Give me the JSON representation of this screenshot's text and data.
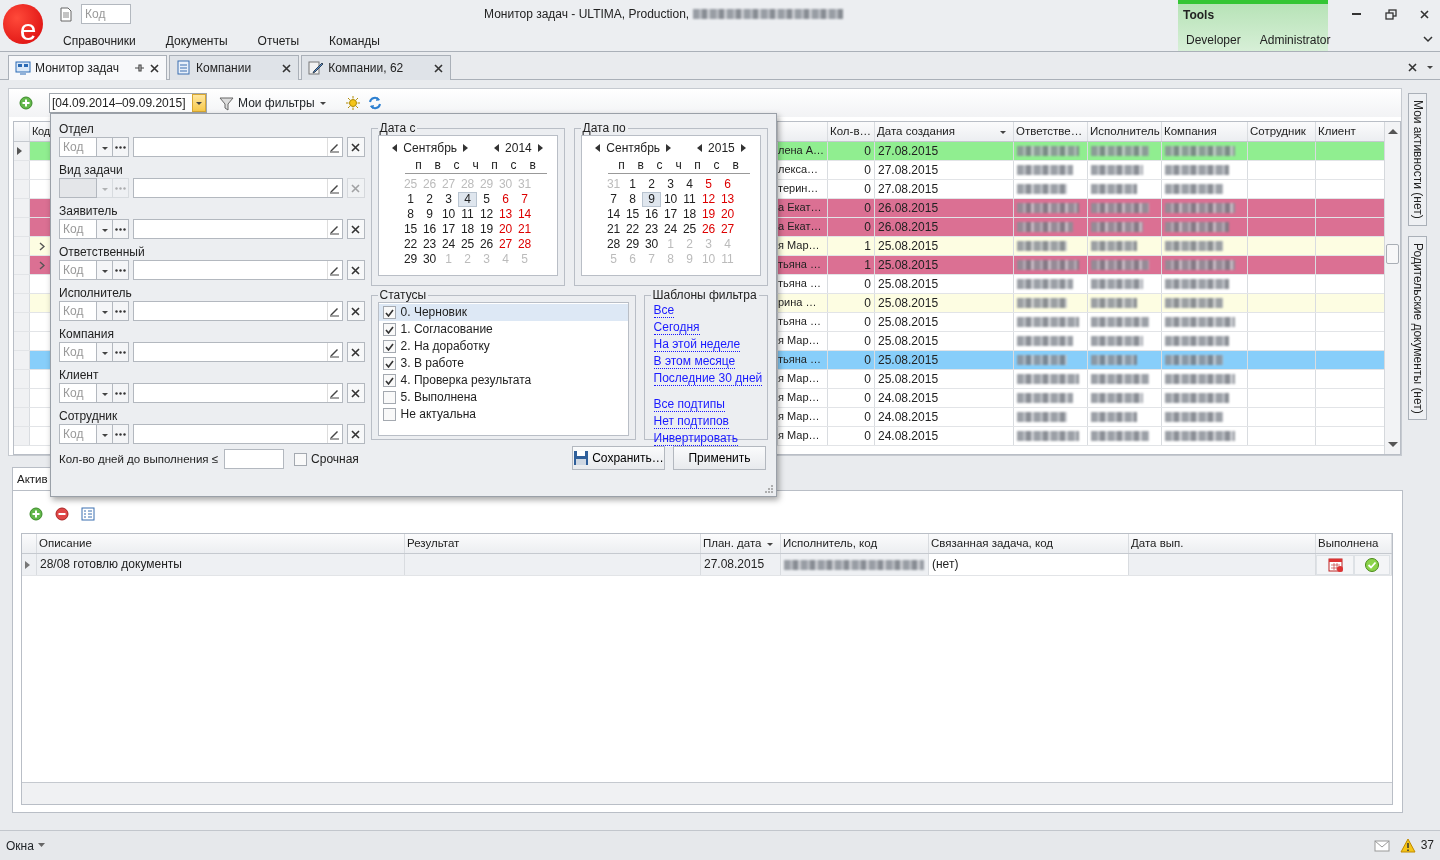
{
  "app": {
    "logo_text": "e",
    "code_field": {
      "placeholder": "Код"
    },
    "title": "Монитор задач - ULTIMA, Production,",
    "menu": [
      "Справочники",
      "Документы",
      "Отчеты",
      "Команды"
    ],
    "tools_group": {
      "title": "Tools",
      "items": [
        "Developer",
        "Administrator"
      ]
    }
  },
  "doc_tabs": [
    {
      "label": "Монитор задач",
      "kind": "monitor",
      "selected": true,
      "pinned": true
    },
    {
      "label": "Компании",
      "kind": "list",
      "selected": false,
      "pinned": false
    },
    {
      "label": "Компании, 62",
      "kind": "edit",
      "selected": false,
      "pinned": false
    }
  ],
  "toolbar": {
    "date_range": "[04.09.2014–09.09.2015]",
    "filters_button": "Мои фильтры"
  },
  "tasks_grid": {
    "columns": [
      {
        "label": "Код"
      },
      {
        "label": "Кол-в…"
      },
      {
        "label": "Дата создания",
        "sorted": true
      },
      {
        "label": "Ответстве…"
      },
      {
        "label": "Исполнитель"
      },
      {
        "label": "Компания"
      },
      {
        "label": "Сотрудник"
      },
      {
        "label": "Клиент"
      }
    ],
    "rows": [
      {
        "name": "лена А…",
        "count": "0",
        "created": "27.08.2015",
        "color": "#90ee90",
        "selected": true,
        "expandable": false
      },
      {
        "name": "лекса…",
        "count": "0",
        "created": "27.08.2015",
        "color": "#ffffff",
        "selected": false,
        "expandable": false
      },
      {
        "name": "терин…",
        "count": "0",
        "created": "27.08.2015",
        "color": "#ffffff",
        "selected": false,
        "expandable": false
      },
      {
        "name": "а Екат…",
        "count": "0",
        "created": "26.08.2015",
        "color": "#db7093",
        "selected": false,
        "expandable": false
      },
      {
        "name": "а Екат…",
        "count": "0",
        "created": "26.08.2015",
        "color": "#db7093",
        "selected": false,
        "expandable": false
      },
      {
        "name": "я Мар…",
        "count": "1",
        "created": "25.08.2015",
        "color": "#fdfde2",
        "selected": false,
        "expandable": true
      },
      {
        "name": "тьяна …",
        "count": "1",
        "created": "25.08.2015",
        "color": "#db7093",
        "selected": false,
        "expandable": true
      },
      {
        "name": "тьяна …",
        "count": "0",
        "created": "25.08.2015",
        "color": "#ffffff",
        "selected": false,
        "expandable": false
      },
      {
        "name": "рина …",
        "count": "0",
        "created": "25.08.2015",
        "color": "#fdfde2",
        "selected": false,
        "expandable": false
      },
      {
        "name": "тьяна …",
        "count": "0",
        "created": "25.08.2015",
        "color": "#ffffff",
        "selected": false,
        "expandable": false
      },
      {
        "name": "я Мар…",
        "count": "0",
        "created": "25.08.2015",
        "color": "#ffffff",
        "selected": false,
        "expandable": false
      },
      {
        "name": "тьяна …",
        "count": "0",
        "created": "25.08.2015",
        "color": "#87cefa",
        "selected": false,
        "expandable": false
      },
      {
        "name": "я Мар…",
        "count": "0",
        "created": "25.08.2015",
        "color": "#ffffff",
        "selected": false,
        "expandable": false
      },
      {
        "name": "я Мар…",
        "count": "0",
        "created": "24.08.2015",
        "color": "#ffffff",
        "selected": false,
        "expandable": false
      },
      {
        "name": "я Мар…",
        "count": "0",
        "created": "24.08.2015",
        "color": "#ffffff",
        "selected": false,
        "expandable": false
      },
      {
        "name": "я Мар…",
        "count": "0",
        "created": "24.08.2015",
        "color": "#ffffff",
        "selected": false,
        "expandable": false
      }
    ]
  },
  "side_tabs": [
    "Мои активности (нет)",
    "Родительские документы (нет)"
  ],
  "detail": {
    "tab": "Актив",
    "columns": [
      {
        "label": "Описание"
      },
      {
        "label": "Результат"
      },
      {
        "label": "План. дата",
        "sorted": true
      },
      {
        "label": "Исполнитель, код"
      },
      {
        "label": "Связанная задача, код"
      },
      {
        "label": "Дата вып."
      },
      {
        "label": "Выполнена"
      }
    ],
    "rows": [
      {
        "description": "28/08 готовлю документы",
        "plan_date": "27.08.2015",
        "related": "(нет)",
        "selected": true
      }
    ]
  },
  "filter_popup": {
    "fields": [
      {
        "label": "Отдел",
        "placeholder": "Код",
        "disabled": false
      },
      {
        "label": "Вид задачи",
        "disabled": true
      },
      {
        "label": "Заявитель",
        "placeholder": "Код",
        "disabled": false
      },
      {
        "label": "Ответственный",
        "placeholder": "Код",
        "disabled": false
      },
      {
        "label": "Исполнитель",
        "placeholder": "Код",
        "disabled": false
      },
      {
        "label": "Компания",
        "placeholder": "Код",
        "disabled": false
      },
      {
        "label": "Клиент",
        "placeholder": "Код",
        "disabled": false
      },
      {
        "label": "Сотрудник",
        "placeholder": "Код",
        "disabled": false
      }
    ],
    "days_label": "Кол-во дней до выполнения ≤",
    "urgent": {
      "label": "Срочная",
      "checked": false
    },
    "calendars": [
      {
        "title": "Дата с",
        "month": "Сентябрь",
        "year": "2014",
        "weekdays": [
          "п",
          "в",
          "с",
          "ч",
          "п",
          "с",
          "в"
        ],
        "weeks": [
          [
            {
              "d": "25",
              "muted": true,
              "selected": false
            },
            {
              "d": "26",
              "muted": true,
              "selected": false
            },
            {
              "d": "27",
              "muted": true,
              "selected": false
            },
            {
              "d": "28",
              "muted": true,
              "selected": false
            },
            {
              "d": "29",
              "muted": true,
              "selected": false
            },
            {
              "d": "30",
              "muted": true,
              "selected": false
            },
            {
              "d": "31",
              "muted": true,
              "selected": false
            }
          ],
          [
            {
              "d": "1",
              "muted": false,
              "selected": false
            },
            {
              "d": "2",
              "muted": false,
              "selected": false
            },
            {
              "d": "3",
              "muted": false,
              "selected": false
            },
            {
              "d": "4",
              "muted": false,
              "selected": true
            },
            {
              "d": "5",
              "muted": false,
              "selected": false
            },
            {
              "d": "6",
              "muted": false,
              "selected": false
            },
            {
              "d": "7",
              "muted": false,
              "selected": false
            }
          ],
          [
            {
              "d": "8",
              "muted": false,
              "selected": false
            },
            {
              "d": "9",
              "muted": false,
              "selected": false
            },
            {
              "d": "10",
              "muted": false,
              "selected": false
            },
            {
              "d": "11",
              "muted": false,
              "selected": false
            },
            {
              "d": "12",
              "muted": false,
              "selected": false
            },
            {
              "d": "13",
              "muted": false,
              "selected": false
            },
            {
              "d": "14",
              "muted": false,
              "selected": false
            }
          ],
          [
            {
              "d": "15",
              "muted": false,
              "selected": false
            },
            {
              "d": "16",
              "muted": false,
              "selected": false
            },
            {
              "d": "17",
              "muted": false,
              "selected": false
            },
            {
              "d": "18",
              "muted": false,
              "selected": false
            },
            {
              "d": "19",
              "muted": false,
              "selected": false
            },
            {
              "d": "20",
              "muted": false,
              "selected": false
            },
            {
              "d": "21",
              "muted": false,
              "selected": false
            }
          ],
          [
            {
              "d": "22",
              "muted": false,
              "selected": false
            },
            {
              "d": "23",
              "muted": false,
              "selected": false
            },
            {
              "d": "24",
              "muted": false,
              "selected": false
            },
            {
              "d": "25",
              "muted": false,
              "selected": false
            },
            {
              "d": "26",
              "muted": false,
              "selected": false
            },
            {
              "d": "27",
              "muted": false,
              "selected": false
            },
            {
              "d": "28",
              "muted": false,
              "selected": false
            }
          ],
          [
            {
              "d": "29",
              "muted": false,
              "selected": false
            },
            {
              "d": "30",
              "muted": false,
              "selected": false
            },
            {
              "d": "1",
              "muted": true,
              "selected": false
            },
            {
              "d": "2",
              "muted": true,
              "selected": false
            },
            {
              "d": "3",
              "muted": true,
              "selected": false
            },
            {
              "d": "4",
              "muted": true,
              "selected": false
            },
            {
              "d": "5",
              "muted": true,
              "selected": false
            }
          ]
        ]
      },
      {
        "title": "Дата по",
        "month": "Сентябрь",
        "year": "2015",
        "weekdays": [
          "п",
          "в",
          "с",
          "ч",
          "п",
          "с",
          "в"
        ],
        "weeks": [
          [
            {
              "d": "31",
              "muted": true,
              "selected": false
            },
            {
              "d": "1",
              "muted": false,
              "selected": false
            },
            {
              "d": "2",
              "muted": false,
              "selected": false
            },
            {
              "d": "3",
              "muted": false,
              "selected": false
            },
            {
              "d": "4",
              "muted": false,
              "selected": false
            },
            {
              "d": "5",
              "muted": false,
              "selected": false
            },
            {
              "d": "6",
              "muted": false,
              "selected": false
            }
          ],
          [
            {
              "d": "7",
              "muted": false,
              "selected": false
            },
            {
              "d": "8",
              "muted": false,
              "selected": false
            },
            {
              "d": "9",
              "muted": false,
              "selected": true
            },
            {
              "d": "10",
              "muted": false,
              "selected": false
            },
            {
              "d": "11",
              "muted": false,
              "selected": false
            },
            {
              "d": "12",
              "muted": false,
              "selected": false
            },
            {
              "d": "13",
              "muted": false,
              "selected": false
            }
          ],
          [
            {
              "d": "14",
              "muted": false,
              "selected": false
            },
            {
              "d": "15",
              "muted": false,
              "selected": false
            },
            {
              "d": "16",
              "muted": false,
              "selected": false
            },
            {
              "d": "17",
              "muted": false,
              "selected": false
            },
            {
              "d": "18",
              "muted": false,
              "selected": false
            },
            {
              "d": "19",
              "muted": false,
              "selected": false
            },
            {
              "d": "20",
              "muted": false,
              "selected": false
            }
          ],
          [
            {
              "d": "21",
              "muted": false,
              "selected": false
            },
            {
              "d": "22",
              "muted": false,
              "selected": false
            },
            {
              "d": "23",
              "muted": false,
              "selected": false
            },
            {
              "d": "24",
              "muted": false,
              "selected": false
            },
            {
              "d": "25",
              "muted": false,
              "selected": false
            },
            {
              "d": "26",
              "muted": false,
              "selected": false
            },
            {
              "d": "27",
              "muted": false,
              "selected": false
            }
          ],
          [
            {
              "d": "28",
              "muted": false,
              "selected": false
            },
            {
              "d": "29",
              "muted": false,
              "selected": false
            },
            {
              "d": "30",
              "muted": false,
              "selected": false
            },
            {
              "d": "1",
              "muted": true,
              "selected": false
            },
            {
              "d": "2",
              "muted": true,
              "selected": false
            },
            {
              "d": "3",
              "muted": true,
              "selected": false
            },
            {
              "d": "4",
              "muted": true,
              "selected": false
            }
          ],
          [
            {
              "d": "5",
              "muted": true,
              "selected": false
            },
            {
              "d": "6",
              "muted": true,
              "selected": false
            },
            {
              "d": "7",
              "muted": true,
              "selected": false
            },
            {
              "d": "8",
              "muted": true,
              "selected": false
            },
            {
              "d": "9",
              "muted": true,
              "selected": false
            },
            {
              "d": "10",
              "muted": true,
              "selected": false
            },
            {
              "d": "11",
              "muted": true,
              "selected": false
            }
          ]
        ]
      }
    ],
    "statuses": {
      "title": "Статусы",
      "items": [
        {
          "label": "0. Черновик",
          "checked": true,
          "selected": true
        },
        {
          "label": "1. Согласование",
          "checked": true,
          "selected": false
        },
        {
          "label": "2. На доработку",
          "checked": true,
          "selected": false
        },
        {
          "label": "3. В работе",
          "checked": true,
          "selected": false
        },
        {
          "label": "4. Проверка результата",
          "checked": true,
          "selected": false
        },
        {
          "label": "5. Выполнена",
          "checked": false,
          "selected": false
        },
        {
          "label": "Не актуальна",
          "checked": false,
          "selected": false
        }
      ]
    },
    "templates": {
      "title": "Шаблоны фильтра",
      "groups": [
        [
          "Все",
          "Сегодня",
          "На этой неделе",
          "В этом месяце",
          "Последние 30 дней"
        ],
        [
          "Все подтипы",
          "Нет подтипов",
          "Инвертировать"
        ]
      ]
    },
    "buttons": {
      "save": "Сохранить…",
      "apply": "Применить"
    }
  },
  "status_bar": {
    "windows_menu": "Окна",
    "warnings": "37"
  }
}
